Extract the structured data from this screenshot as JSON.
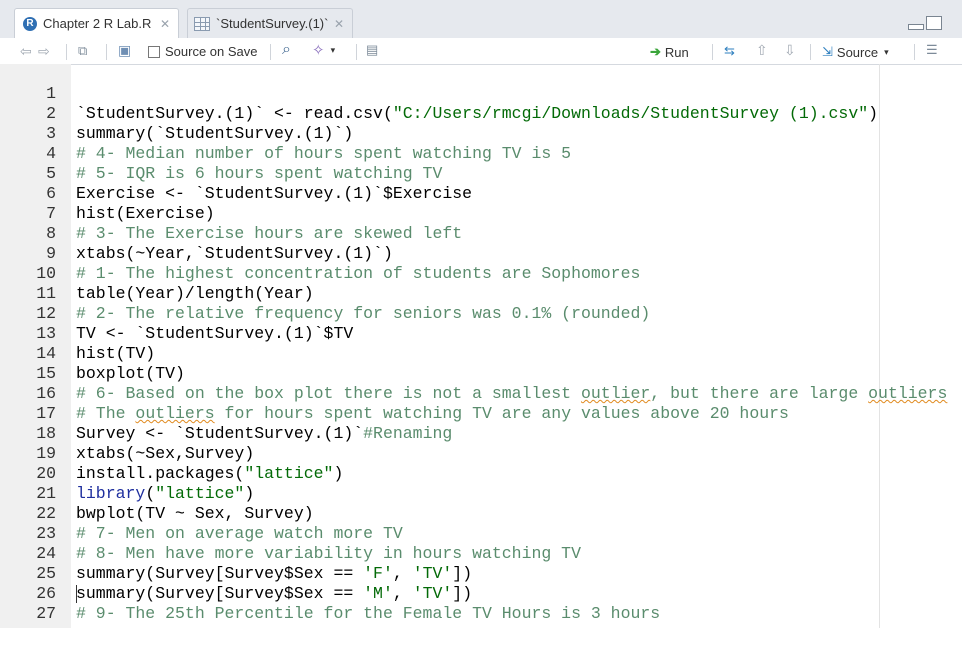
{
  "tabs": [
    {
      "label": "Chapter 2 R Lab.R",
      "icon": "r-file-icon",
      "active": true
    },
    {
      "label": "`StudentSurvey.(1)`",
      "icon": "table-icon",
      "active": false
    }
  ],
  "toolbar": {
    "source_on_save_label": "Source on Save",
    "run_label": "Run",
    "source_label": "Source"
  },
  "editor": {
    "lines": [
      {
        "n": "1",
        "text": "`StudentSurvey.(1)` <- read.csv(\"C:/Users/rmcgi/Downloads/StudentSurvey (1).csv\")"
      },
      {
        "n": "2",
        "text": "summary(`StudentSurvey.(1)`)"
      },
      {
        "n": "3",
        "text": "# 4- Median number of hours spent watching TV is 5"
      },
      {
        "n": "4",
        "text": "# 5- IQR is 6 hours spent watching TV"
      },
      {
        "n": "5",
        "text": "Exercise <- `StudentSurvey.(1)`$Exercise"
      },
      {
        "n": "6",
        "text": "hist(Exercise)"
      },
      {
        "n": "7",
        "text": "# 3- The Exercise hours are skewed left"
      },
      {
        "n": "8",
        "text": "xtabs(~Year,`StudentSurvey.(1)`)"
      },
      {
        "n": "9",
        "text": "# 1- The highest concentration of students are Sophomores"
      },
      {
        "n": "10",
        "text": "table(Year)/length(Year)"
      },
      {
        "n": "11",
        "text": "# 2- The relative frequency for seniors was 0.1% (rounded)"
      },
      {
        "n": "12",
        "text": "TV <- `StudentSurvey.(1)`$TV"
      },
      {
        "n": "13",
        "text": "hist(TV)"
      },
      {
        "n": "14",
        "text": "boxplot(TV)"
      },
      {
        "n": "15",
        "text": "# 6- Based on the box plot there is not a smallest outlier, but there are large outliers"
      },
      {
        "n": "16",
        "text": "# The outliers for hours spent watching TV are any values above 20 hours"
      },
      {
        "n": "17",
        "text": "Survey <- `StudentSurvey.(1)`#Renaming"
      },
      {
        "n": "18",
        "text": "xtabs(~Sex,Survey)"
      },
      {
        "n": "19",
        "text": "install.packages(\"lattice\")"
      },
      {
        "n": "20",
        "text": "library(\"lattice\")"
      },
      {
        "n": "21",
        "text": "bwplot(TV ~ Sex, Survey)"
      },
      {
        "n": "22",
        "text": "# 7- Men on average watch more TV"
      },
      {
        "n": "23",
        "text": "# 8- Men have more variability in hours watching TV"
      },
      {
        "n": "24",
        "text": "summary(Survey[Survey$Sex == 'F', 'TV'])"
      },
      {
        "n": "25",
        "text": "summary(Survey[Survey$Sex == 'M', 'TV'])"
      },
      {
        "n": "26",
        "text": "# 9- The 25th Percentile for the Female TV Hours is 3 hours"
      },
      {
        "n": "27",
        "text": ""
      }
    ]
  },
  "colors": {
    "comment": "#5a8c6d",
    "string": "#036a07",
    "function": "#1f2f9e",
    "gutter": "#f0f0f0"
  }
}
